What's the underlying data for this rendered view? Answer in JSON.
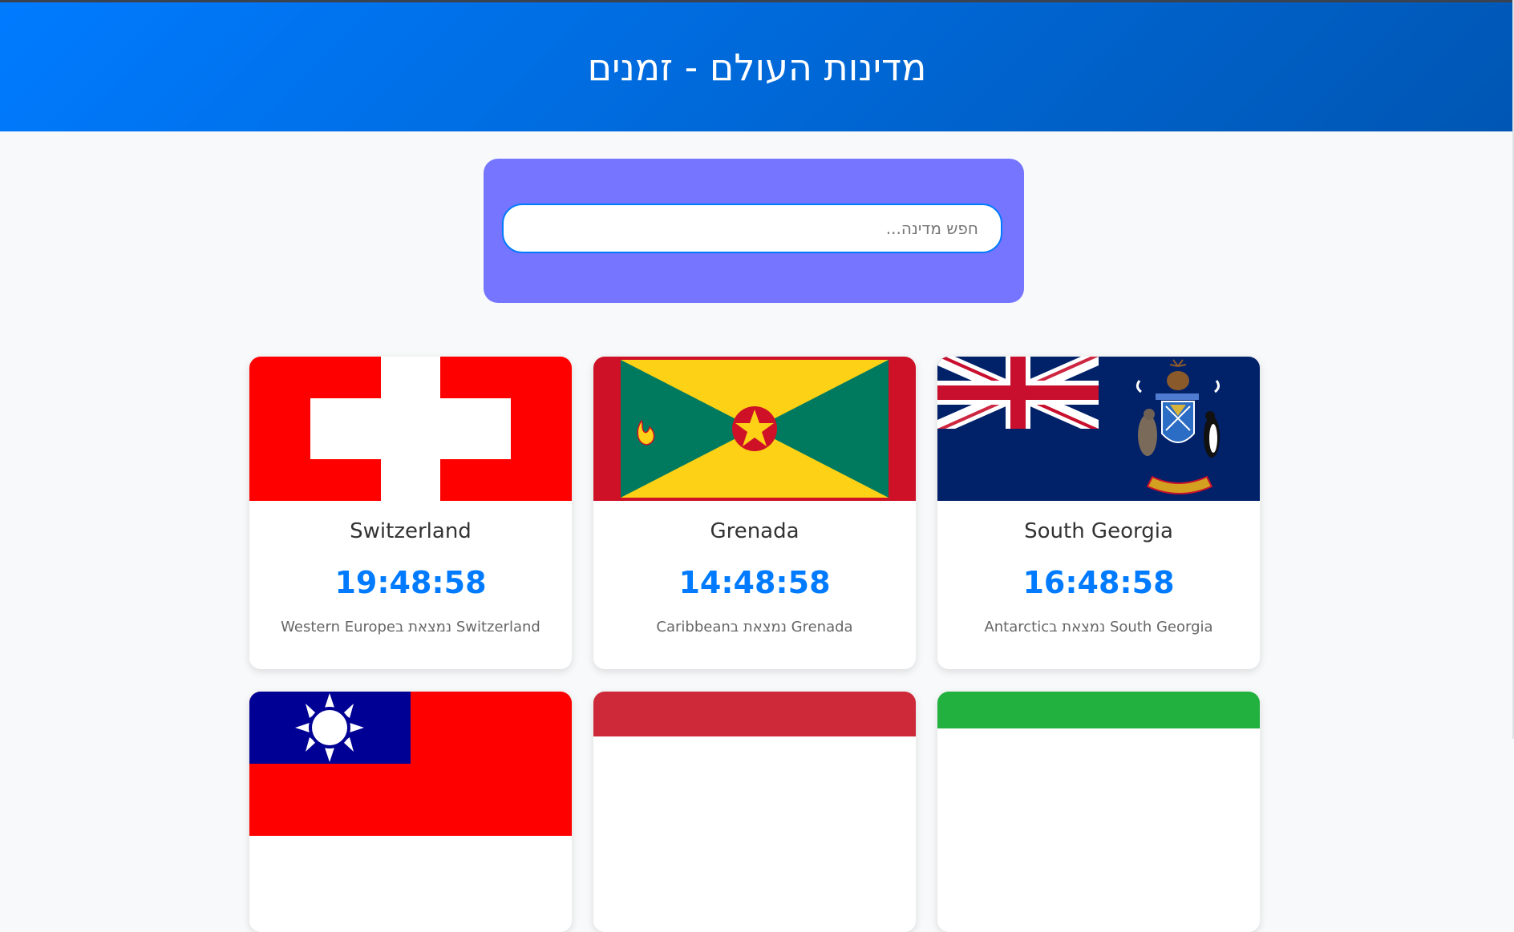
{
  "header": {
    "title": "מדינות העולם - זמנים"
  },
  "search": {
    "placeholder": "חפש מדינה...",
    "value": ""
  },
  "countries": [
    {
      "name": "Switzerland",
      "time": "19:48:58",
      "region_text": "Western Europeנמצאת ב Switzerland",
      "flag_icon": "switzerland-flag"
    },
    {
      "name": "Grenada",
      "time": "14:48:58",
      "region_text": "Caribbeanנמצאת ב Grenada",
      "flag_icon": "grenada-flag"
    },
    {
      "name": "South Georgia",
      "time": "16:48:58",
      "region_text": "Antarcticנמצאת ב South Georgia",
      "flag_icon": "south-georgia-flag"
    }
  ],
  "partial_cards": [
    {
      "flag_icon": "taiwan-flag"
    },
    {
      "flag_icon": "red-flag"
    },
    {
      "flag_icon": "green-flag"
    }
  ],
  "colors": {
    "header_gradient_start": "#007bff",
    "header_gradient_end": "#0056b3",
    "search_panel": "#7575ff",
    "accent": "#007bff",
    "page_bg": "#f8f9fa"
  }
}
